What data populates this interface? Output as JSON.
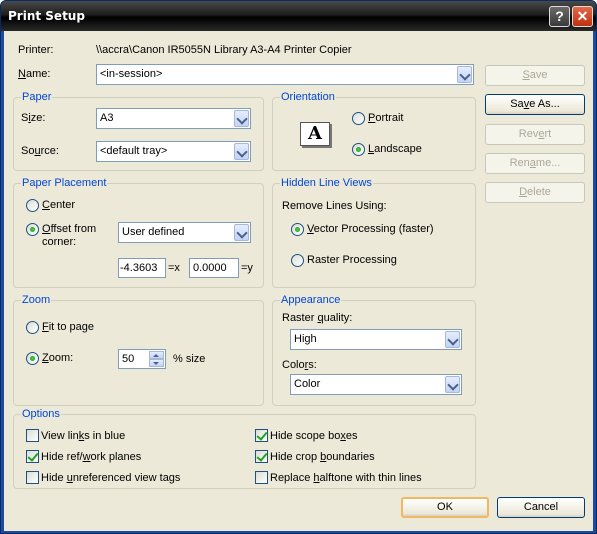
{
  "window": {
    "title": "Print Setup",
    "help_glyph": "?",
    "close_glyph": "✕"
  },
  "printer": {
    "label": "Printer:",
    "value": "\\\\accra\\Canon IR5055N Library A3-A4 Printer Copier"
  },
  "name": {
    "label_pre": "",
    "label_u": "N",
    "label_post": "ame:",
    "value": "<in-session>"
  },
  "side_buttons": {
    "save": {
      "pre": "",
      "u": "S",
      "post": "ave"
    },
    "save_as": {
      "pre": "Sa",
      "u": "v",
      "post": "e As..."
    },
    "revert": {
      "pre": "Rev",
      "u": "e",
      "post": "rt"
    },
    "rename": {
      "pre": "Ren",
      "u": "a",
      "post": "me..."
    },
    "delete": {
      "pre": "",
      "u": "D",
      "post": "elete"
    }
  },
  "paper": {
    "title": "Paper",
    "size_label": {
      "pre": "S",
      "u": "i",
      "post": "ze:"
    },
    "size_value": "A3",
    "source_label": {
      "pre": "So",
      "u": "u",
      "post": "rce:"
    },
    "source_value": "<default tray>"
  },
  "orientation": {
    "title": "Orientation",
    "icon_letter": "A",
    "portrait": {
      "pre": "",
      "u": "P",
      "post": "ortrait"
    },
    "landscape": {
      "pre": "",
      "u": "L",
      "post": "andscape"
    },
    "selected": "landscape"
  },
  "paper_placement": {
    "title": "Paper Placement",
    "center": {
      "pre": "",
      "u": "C",
      "post": "enter"
    },
    "offset_line1": {
      "pre": "",
      "u": "O",
      "post": "ffset from"
    },
    "offset_line2": "corner:",
    "offset_value": "User defined",
    "x_value": "-4.3603",
    "x_suffix": "=x",
    "y_value": "0.0000",
    "y_suffix": "=y",
    "selected": "offset"
  },
  "hidden_line_views": {
    "title": "Hidden Line Views",
    "remove_label": "Remove Lines Using:",
    "vector": {
      "pre": "",
      "u": "V",
      "post": "ector Processing (faster)"
    },
    "raster": {
      "pre": "Raster Processin",
      "u": "g",
      "post": ""
    },
    "selected": "vector"
  },
  "zoom": {
    "title": "Zoom",
    "fit": {
      "pre": "",
      "u": "F",
      "post": "it to page"
    },
    "zoom": {
      "pre": "",
      "u": "Z",
      "post": "oom:"
    },
    "zoom_value": "50",
    "zoom_suffix": "% size",
    "selected": "zoom"
  },
  "appearance": {
    "title": "Appearance",
    "raster_label": {
      "pre": "Raster ",
      "u": "q",
      "post": "uality:"
    },
    "raster_value": "High",
    "colors_label": {
      "pre": "Colo",
      "u": "r",
      "post": "s:"
    },
    "colors_value": "Color"
  },
  "options": {
    "title": "Options",
    "items": [
      {
        "pre": "View lin",
        "u": "k",
        "post": "s in blue",
        "checked": false
      },
      {
        "pre": "Hide scope bo",
        "u": "x",
        "post": "es",
        "checked": true
      },
      {
        "pre": "Hide ref/",
        "u": "w",
        "post": "ork planes",
        "checked": true
      },
      {
        "pre": "Hide crop ",
        "u": "b",
        "post": "oundaries",
        "checked": true
      },
      {
        "pre": "Hide ",
        "u": "u",
        "post": "nreferenced view tags",
        "checked": false
      },
      {
        "pre": "Replace ",
        "u": "h",
        "post": "alftone with thin lines",
        "checked": false
      }
    ]
  },
  "footer": {
    "ok": "OK",
    "cancel": "Cancel"
  },
  "colors": {
    "title_bar": "#1e1e1e",
    "dialog_bg": "#ece9d8",
    "group_title": "#0046d5",
    "accent_check": "#21a121"
  }
}
